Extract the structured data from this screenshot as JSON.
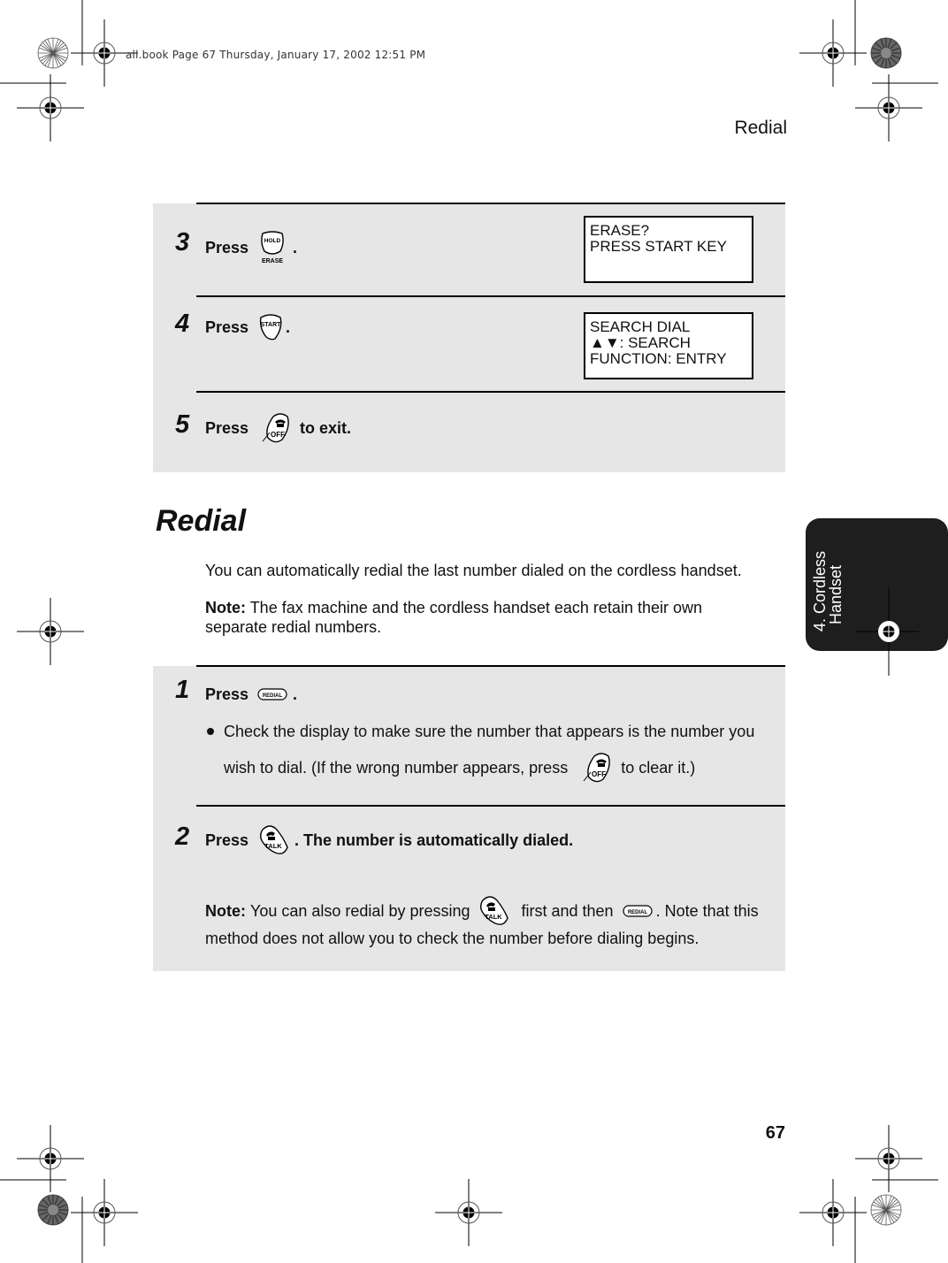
{
  "slug": "all.book  Page 67  Thursday, January 17, 2002  12:51 PM",
  "running_head": "Redial",
  "page_number": "67",
  "side_tab": {
    "line1": "4. Cordless",
    "line2": "Handset"
  },
  "colors": {
    "panel": "#e6e6e6",
    "tab": "#1e1e1e",
    "text": "#111111"
  },
  "erase_steps": [
    {
      "num": "3",
      "press": "Press",
      "key": "HOLD/ERASE",
      "key_top": "HOLD",
      "key_bottom": "ERASE",
      "after": ".",
      "display": [
        "ERASE?",
        "PRESS START KEY"
      ]
    },
    {
      "num": "4",
      "press": "Press",
      "key": "START",
      "after": ".",
      "display": [
        "SEARCH DIAL",
        "▲▼: SEARCH",
        "FUNCTION: ENTRY"
      ]
    },
    {
      "num": "5",
      "press": "Press",
      "key": "OFF",
      "after": "to exit."
    }
  ],
  "section": {
    "title": "Redial",
    "intro": "You can automatically redial the last number dialed on the cordless handset.",
    "note_label": "Note:",
    "note_line1": "The fax machine and the cordless handset each retain their own",
    "note_line2": "separate redial numbers."
  },
  "redial_steps": [
    {
      "num": "1",
      "press": "Press",
      "key": "REDIAL",
      "after": ".",
      "bullet_line1": "Check the display to make sure the number that appears is the number you",
      "bullet_line2_pre": "wish to dial. (If the wrong number appears, press",
      "bullet_key": "OFF",
      "bullet_line2_post": "to clear it.)"
    },
    {
      "num": "2",
      "press": "Press",
      "key": "TALK",
      "after": ". The number is automatically dialed.",
      "note_label": "Note:",
      "note_pre": "You can also redial by pressing",
      "note_key1": "TALK",
      "note_mid": "first and then",
      "note_key2": "REDIAL",
      "note_post": ". Note that this",
      "note_line2": "method does not allow you to check the number before dialing begins."
    }
  ],
  "icons": {
    "hold_erase": "hold-erase-key-icon",
    "start": "start-key-icon",
    "off": "off-phone-key-icon",
    "redial": "redial-key-icon",
    "talk": "talk-phone-key-icon"
  }
}
